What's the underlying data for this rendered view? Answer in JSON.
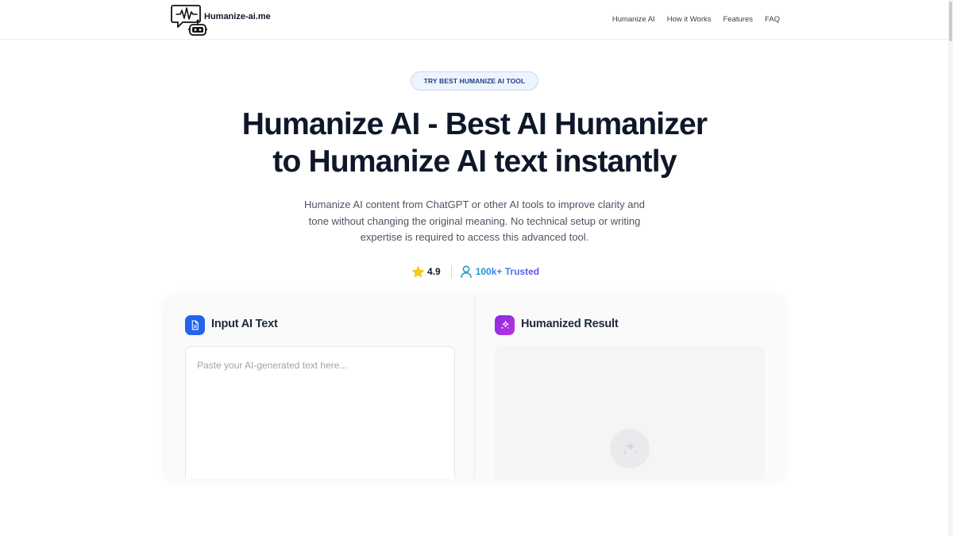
{
  "header": {
    "brand": "Humanize-ai.me",
    "nav": [
      {
        "label": "Humanize AI"
      },
      {
        "label": "How it Works"
      },
      {
        "label": "Features"
      },
      {
        "label": "FAQ"
      }
    ]
  },
  "hero": {
    "badge": "TRY BEST HUMANIZE AI TOOL",
    "title_line1": "Humanize AI - Best AI Humanizer",
    "title_line2": "to Humanize AI text instantly",
    "subtitle": "Humanize AI content from ChatGPT or other AI tools to improve clarity and tone without changing the original meaning. No technical setup or writing expertise is required to access this advanced tool.",
    "rating": "4.9",
    "trusted": "100k+ Trusted"
  },
  "tool": {
    "input_title": "Input AI Text",
    "input_placeholder": "Paste your AI-generated text here...",
    "result_title": "Humanized Result"
  },
  "icons": {
    "logo": "robot-chat-logo-icon",
    "rating": "star-icon",
    "trusted": "user-icon",
    "input": "document-icon",
    "result": "sparkles-icon",
    "result_placeholder": "sparkles-icon"
  },
  "colors": {
    "accent_blue": "#2563eb",
    "accent_purple": "#9b30e2",
    "badge_text": "#1d3f8a",
    "star": "#facc15",
    "heading": "#0f172a"
  }
}
